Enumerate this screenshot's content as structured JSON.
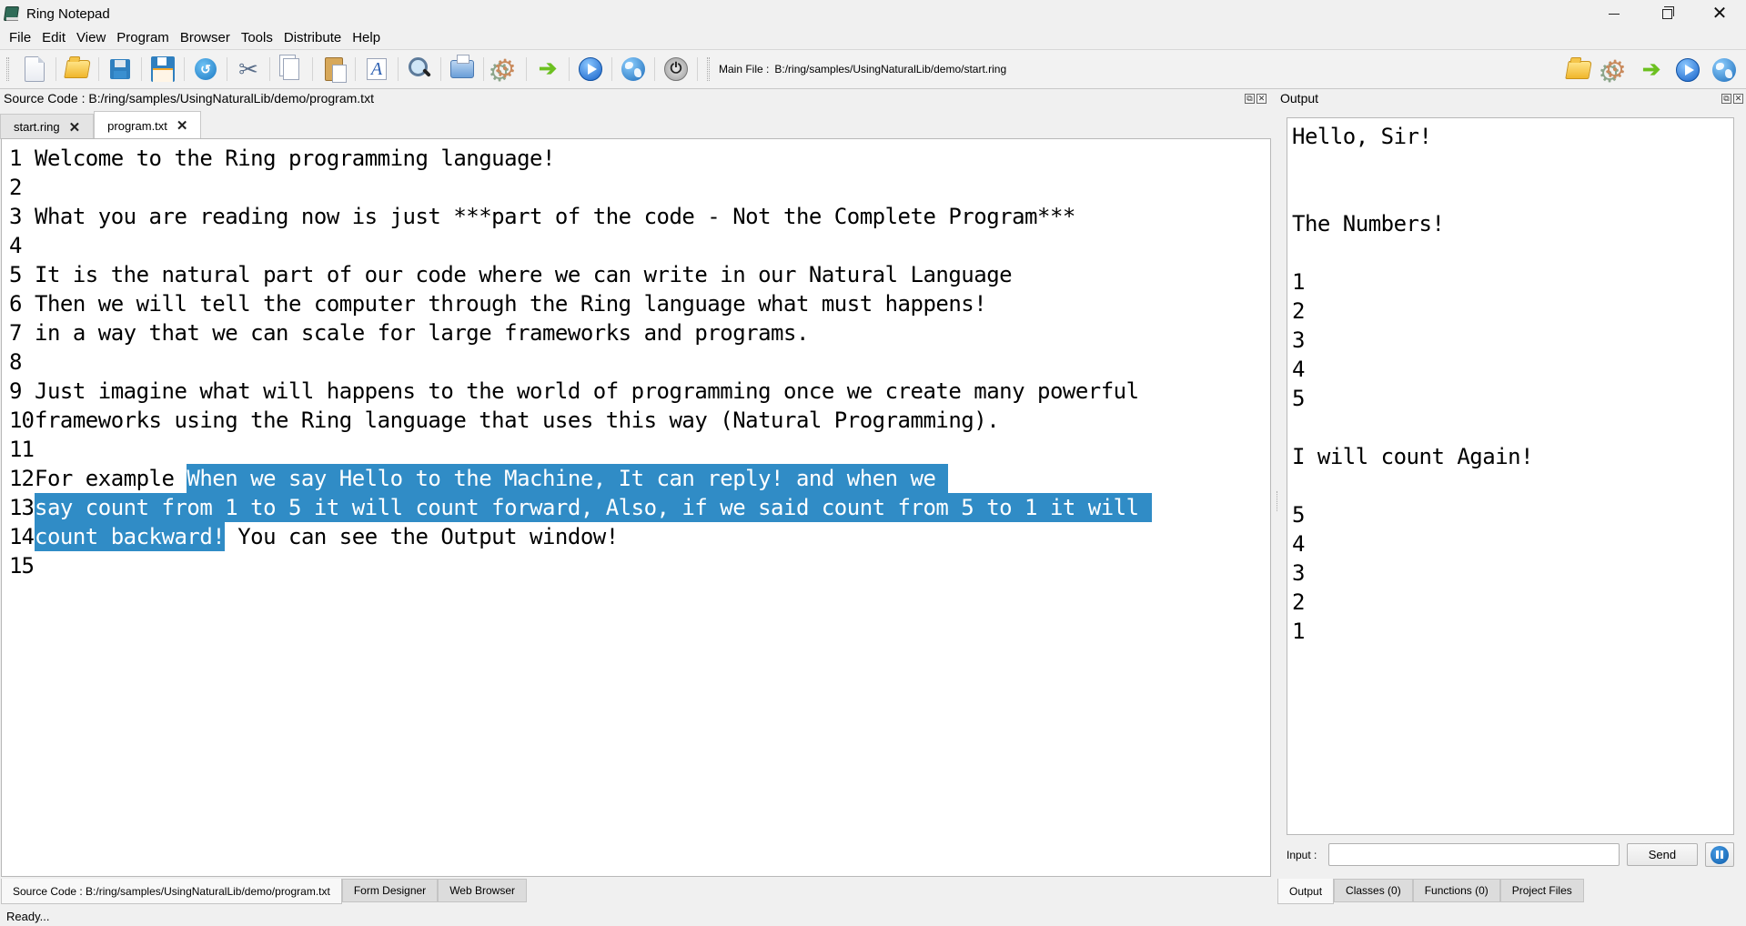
{
  "window": {
    "title": "Ring Notepad",
    "controls": {
      "minimize": "minimize",
      "maximize": "restore",
      "close": "close"
    }
  },
  "menubar": [
    "File",
    "Edit",
    "View",
    "Program",
    "Browser",
    "Tools",
    "Distribute",
    "Help"
  ],
  "toolbar": {
    "buttons": [
      {
        "name": "new-file",
        "icon": "new-file-icon"
      },
      {
        "name": "open-file",
        "icon": "folder-icon"
      },
      {
        "name": "save",
        "icon": "save-icon"
      },
      {
        "name": "save-as",
        "icon": "save-as-icon"
      },
      {
        "name": "reload",
        "icon": "reload-icon"
      },
      {
        "name": "cut",
        "icon": "scissors-icon"
      },
      {
        "name": "copy",
        "icon": "copy-icon"
      },
      {
        "name": "paste",
        "icon": "paste-icon"
      },
      {
        "name": "font",
        "icon": "font-icon"
      },
      {
        "name": "find",
        "icon": "search-icon"
      },
      {
        "name": "print",
        "icon": "printer-icon"
      },
      {
        "name": "debug",
        "icon": "gear-icon"
      },
      {
        "name": "run",
        "icon": "arrow-right-icon"
      },
      {
        "name": "run-gui",
        "icon": "play-icon"
      },
      {
        "name": "run-web",
        "icon": "globe-icon"
      },
      {
        "name": "stop",
        "icon": "power-icon"
      }
    ],
    "main_file_label": "Main File :",
    "main_file_path": "B:/ring/samples/UsingNaturalLib/demo/start.ring",
    "right_buttons": [
      {
        "name": "open-main-file",
        "icon": "folder-icon"
      },
      {
        "name": "debug-main-file",
        "icon": "gear-icon"
      },
      {
        "name": "run-main-file",
        "icon": "arrow-right-icon"
      },
      {
        "name": "run-gui-main-file",
        "icon": "play-icon"
      },
      {
        "name": "run-web-main-file",
        "icon": "globe-icon"
      }
    ]
  },
  "source_dock": {
    "title": "Source Code : B:/ring/samples/UsingNaturalLib/demo/program.txt",
    "tabs": [
      {
        "label": "start.ring",
        "active": false
      },
      {
        "label": "program.txt",
        "active": true
      }
    ],
    "lines": [
      {
        "n": "1",
        "pre": "Welcome to the Ring programming language!",
        "sel": "",
        "post": ""
      },
      {
        "n": "2",
        "pre": "",
        "sel": "",
        "post": ""
      },
      {
        "n": "3",
        "pre": "What you are reading now is just ***part of the code - Not the Complete Program***",
        "sel": "",
        "post": ""
      },
      {
        "n": "4",
        "pre": "",
        "sel": "",
        "post": ""
      },
      {
        "n": "5",
        "pre": "It is the natural part of our code where we can write in our Natural Language",
        "sel": "",
        "post": ""
      },
      {
        "n": "6",
        "pre": "Then we will tell the computer through the Ring language what must happens!",
        "sel": "",
        "post": ""
      },
      {
        "n": "7",
        "pre": "in a way that we can scale for large frameworks and programs.",
        "sel": "",
        "post": ""
      },
      {
        "n": "8",
        "pre": "",
        "sel": "",
        "post": ""
      },
      {
        "n": "9",
        "pre": "Just imagine what will happens to the world of programming once we create many powerful",
        "sel": "",
        "post": ""
      },
      {
        "n": "10",
        "pre": "frameworks using the Ring language that uses this way (Natural Programming).",
        "sel": "",
        "post": ""
      },
      {
        "n": "11",
        "pre": "",
        "sel": "",
        "post": ""
      },
      {
        "n": "12",
        "pre": "For example ",
        "sel": "When we say Hello to the Machine, It can reply! and when we ",
        "post": ""
      },
      {
        "n": "13",
        "pre": "",
        "sel": "say count from 1 to 5 it will count forward, Also, if we said count from 5 to 1 it will ",
        "post": ""
      },
      {
        "n": "14",
        "pre": "",
        "sel": "count backward!",
        "post": " You can see the Output window!"
      },
      {
        "n": "15",
        "pre": "",
        "sel": "",
        "post": ""
      }
    ],
    "selection_color": "#308cc6"
  },
  "output_dock": {
    "title": "Output",
    "lines": [
      "Hello, Sir!",
      "",
      "",
      "The Numbers!",
      "",
      "1",
      "2",
      "3",
      "4",
      "5",
      "",
      "I will count Again!",
      "",
      "5",
      "4",
      "3",
      "2",
      "1"
    ],
    "input_label": "Input :",
    "input_value": "",
    "send_label": "Send"
  },
  "bottom_tabs_left": [
    {
      "label": "Source Code : B:/ring/samples/UsingNaturalLib/demo/program.txt",
      "active": true
    },
    {
      "label": "Form Designer",
      "active": false
    },
    {
      "label": "Web Browser",
      "active": false
    }
  ],
  "bottom_tabs_right": [
    {
      "label": "Output",
      "active": true
    },
    {
      "label": "Classes (0)",
      "active": false
    },
    {
      "label": "Functions (0)",
      "active": false
    },
    {
      "label": "Project Files",
      "active": false
    }
  ],
  "status": "Ready..."
}
